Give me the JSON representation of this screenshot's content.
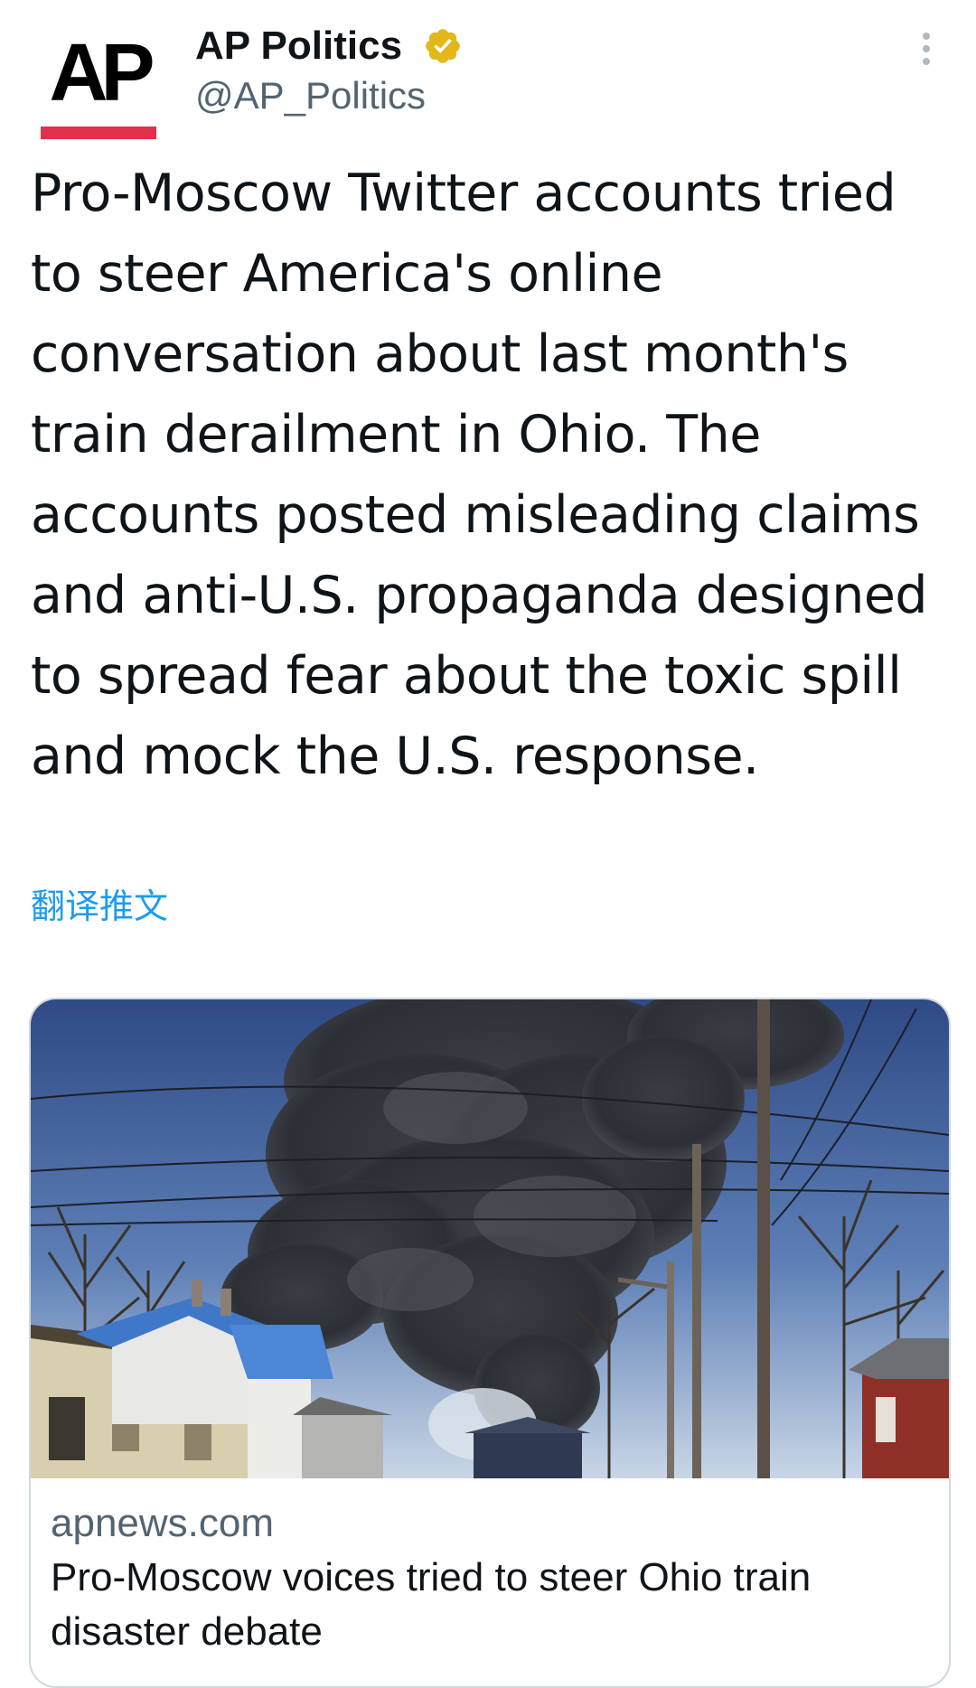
{
  "account": {
    "avatar_text": "AP",
    "display_name": "AP Politics",
    "handle": "@AP_Politics",
    "verified_icon": "verified-badge-icon",
    "more_icon": "more-vertical-icon"
  },
  "tweet": {
    "text": "Pro-Moscow Twitter accounts tried to steer America's online conversation about last month's train derailment in Ohio. The accounts posted misleading claims and anti-U.S. propaganda designed to spread fear about the toxic spill and mock the U.S. response.",
    "translate_label": "翻译推文"
  },
  "card": {
    "domain": "apnews.com",
    "title": "Pro-Moscow voices tried to steer Ohio train disaster debate"
  },
  "colors": {
    "accent_link": "#1d9bf0",
    "ap_red": "#e0304b",
    "verified_gold": "#e2b719",
    "secondary_text": "#536471",
    "primary_text": "#0f1419",
    "card_border": "#cfd9de"
  }
}
